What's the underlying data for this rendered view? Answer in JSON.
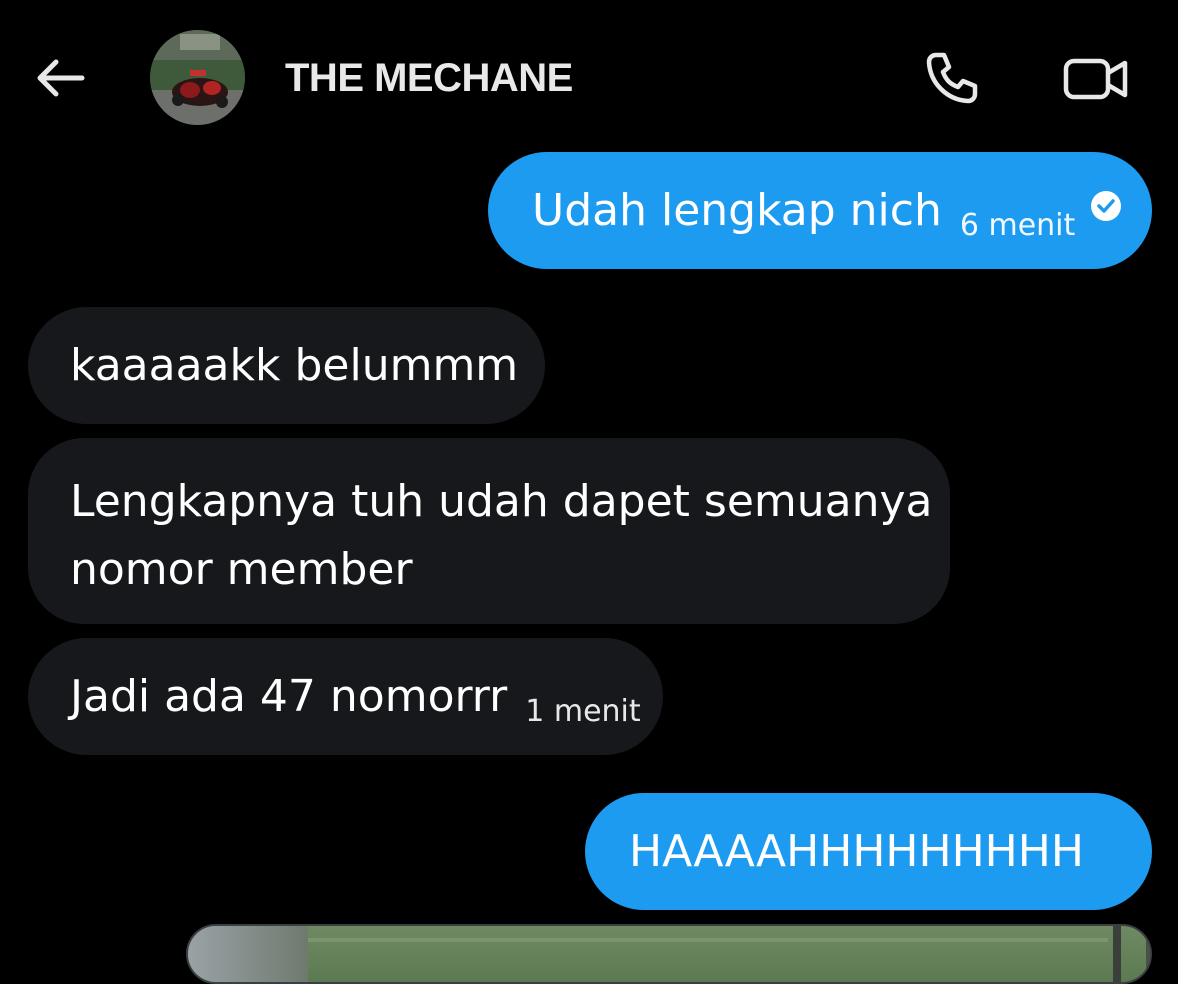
{
  "header": {
    "back_icon": "arrow-left-icon",
    "contact_name": "THE MECHANE",
    "call_icon": "phone-icon",
    "video_icon": "video-camera-icon"
  },
  "messages": [
    {
      "direction": "out",
      "text": "Udah lengkap nich",
      "time": "6 menit",
      "status_icon": "read-check-icon"
    },
    {
      "direction": "in",
      "text": "kaaaaakk belummm"
    },
    {
      "direction": "in",
      "lines": [
        "Lengkapnya tuh udah dapet semuanya",
        "nomor member"
      ]
    },
    {
      "direction": "in",
      "text": "Jadi ada 47 nomorrr",
      "time": "1 menit"
    },
    {
      "direction": "out",
      "text": "HAAAAHHHHHHHHH"
    }
  ],
  "colors": {
    "background": "#000000",
    "outgoing_bubble": "#1d9bf0",
    "incoming_bubble": "#16181c",
    "text": "#ffffff"
  }
}
